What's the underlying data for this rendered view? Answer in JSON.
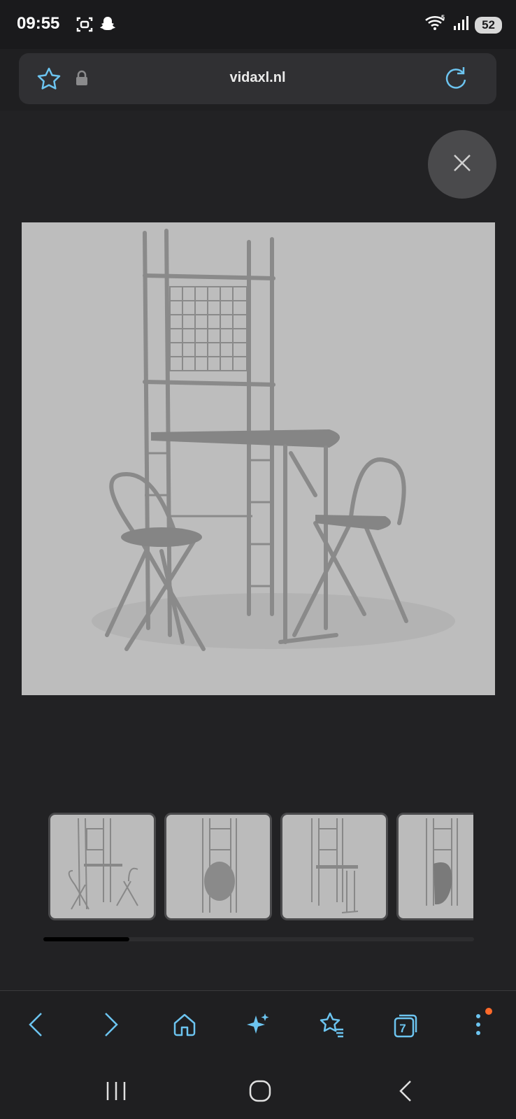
{
  "status_bar": {
    "time": "09:55",
    "battery": "52",
    "icons": [
      "screenshot-icon",
      "snapchat-icon",
      "wifi-icon",
      "signal-icon"
    ]
  },
  "url_bar": {
    "domain": "vidaxl.nl",
    "icons": [
      "star-icon",
      "lock-icon",
      "reload-icon"
    ]
  },
  "viewer": {
    "close_icon": "close-icon",
    "main_image": "folding breakfast bar set with two chairs",
    "thumbnails": [
      {
        "name": "thumb-set-with-chairs"
      },
      {
        "name": "thumb-set-folded"
      },
      {
        "name": "thumb-table-only"
      },
      {
        "name": "thumb-folded-side"
      }
    ],
    "scroll_progress": 0.2
  },
  "toolbar": {
    "tab_count": "7",
    "items": [
      "back",
      "forward",
      "home",
      "ai-assistant",
      "bookmarks",
      "tabs",
      "menu"
    ]
  },
  "colors": {
    "accent": "#6cc4f0",
    "background": "#222224",
    "notification": "#ff6a2a"
  }
}
